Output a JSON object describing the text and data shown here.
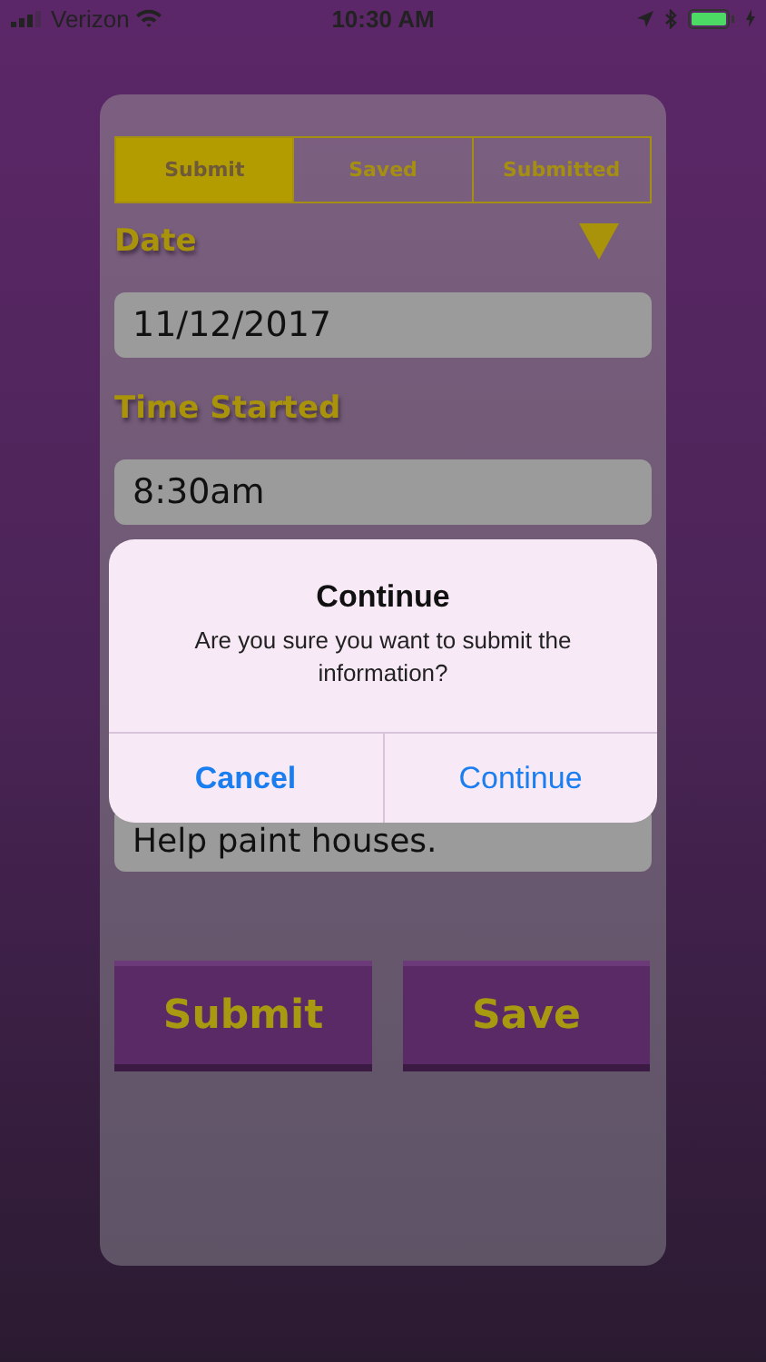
{
  "status_bar": {
    "carrier": "Verizon",
    "time": "10:30 AM"
  },
  "tabs": [
    {
      "label": "Submit",
      "selected": true
    },
    {
      "label": "Saved",
      "selected": false
    },
    {
      "label": "Submitted",
      "selected": false
    }
  ],
  "fields": [
    {
      "label": "Date",
      "value": "11/12/2017",
      "dropdown": true
    },
    {
      "label": "Time Started",
      "value": "8:30am"
    },
    {
      "value": "Help paint houses."
    }
  ],
  "buttons": [
    "Submit",
    "Save"
  ],
  "alert": {
    "title": "Continue",
    "message": "Are you sure you want to submit the information?",
    "buttons": [
      {
        "label": "Cancel",
        "bold": true
      },
      {
        "label": "Continue",
        "bold": false
      }
    ]
  }
}
